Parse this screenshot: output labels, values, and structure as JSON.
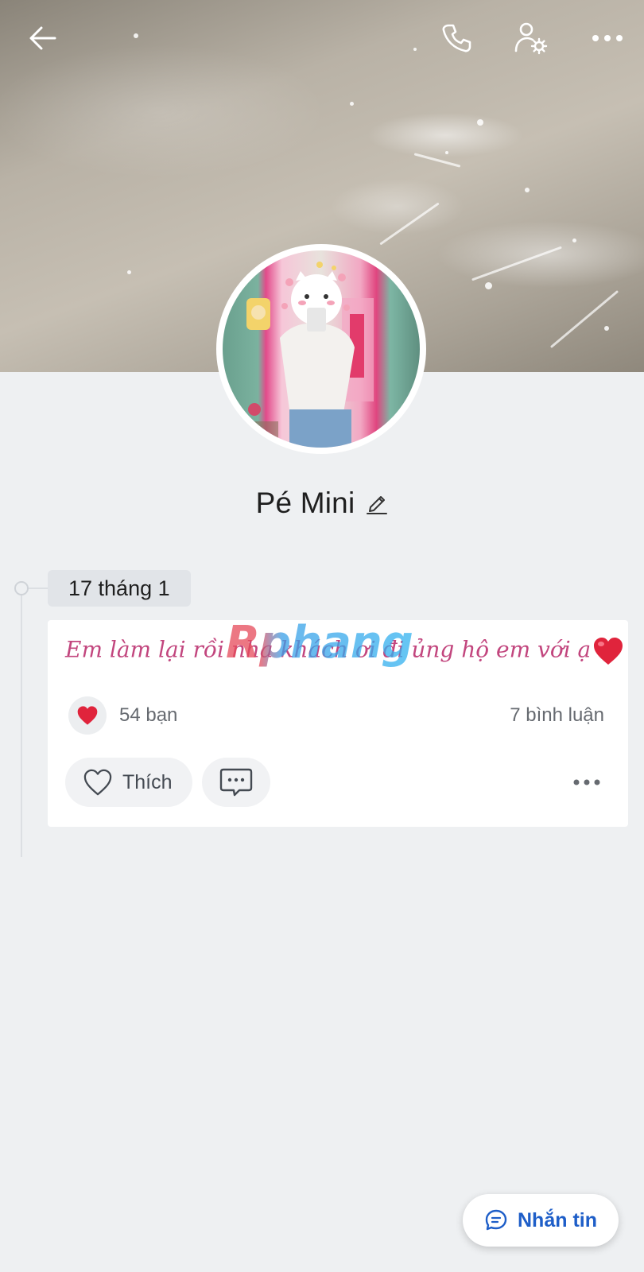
{
  "header": {
    "back_icon": "arrow-left-icon",
    "call_icon": "phone-icon",
    "settings_icon": "user-gear-icon",
    "more_icon": "more-horizontal-icon"
  },
  "profile": {
    "name": "Pé Mini",
    "edit_icon": "pencil-icon"
  },
  "timeline": {
    "date": "17 tháng 1"
  },
  "post": {
    "text": "Em làm lại rồi nha khách ơi đi ủng hộ em với ạ",
    "watermark": "Rphang",
    "reaction_count": "54 bạn",
    "comment_count": "7 bình luận",
    "like_label": "Thích"
  },
  "footer": {
    "message_label": "Nhắn tin"
  },
  "colors": {
    "accent_blue": "#1e5ec8",
    "post_text_pink": "#c2467e",
    "heart_red": "#e0243c",
    "page_background": "#eef0f2"
  }
}
